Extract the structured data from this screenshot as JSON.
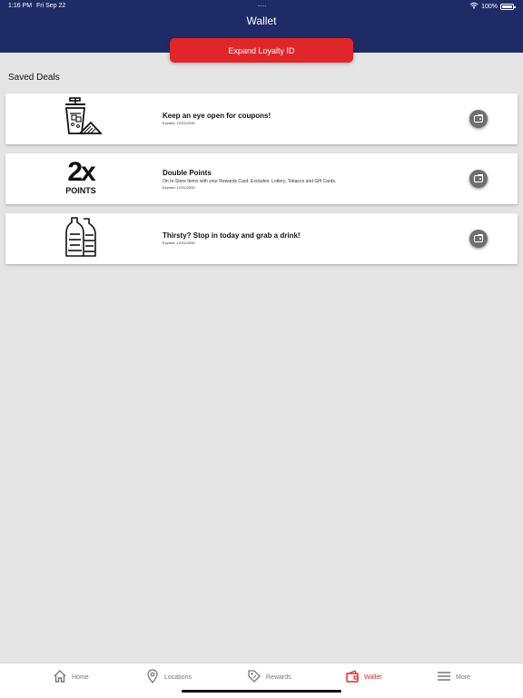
{
  "status_bar": {
    "time": "1:16 PM",
    "date": "Fri Sep 22",
    "battery": "100%",
    "icons": [
      "wifi-icon",
      "battery-icon"
    ]
  },
  "header": {
    "title": "Wallet",
    "background_color": "#1f2b66"
  },
  "loyalty": {
    "button_label": "Expand Loyalty ID",
    "color": "#e0262b"
  },
  "saved_deals": {
    "heading": "Saved Deals",
    "items": [
      {
        "image_icon": "soda-cup-nachos-icon",
        "title": "Keep an eye open for coupons!",
        "expiry": "Expires: 12/31/2030",
        "action_icon": "wallet-icon"
      },
      {
        "image_text": "2x",
        "image_subtext": "POINTS",
        "title": "Double Points",
        "description": "On In-Store Items with your Rewards Card. Excludes: Lottery, Tobacco and Gift Cards.",
        "expiry": "Expires: 12/31/2030",
        "action_icon": "wallet-icon"
      },
      {
        "image_icon": "bottles-icon",
        "title": "Thirsty? Stop in today and grab a drink!",
        "expiry": "Expires: 12/31/2030",
        "action_icon": "wallet-icon"
      }
    ]
  },
  "tabbar": {
    "items": [
      {
        "label": "Home",
        "icon": "home-icon"
      },
      {
        "label": "Locations",
        "icon": "location-pin-icon"
      },
      {
        "label": "Rewards",
        "icon": "tag-icon"
      },
      {
        "label": "Wallet",
        "icon": "wallet-icon",
        "selected": true
      },
      {
        "label": "More",
        "icon": "menu-icon"
      }
    ],
    "active_color": "#e0262b",
    "inactive_color": "#777777"
  }
}
